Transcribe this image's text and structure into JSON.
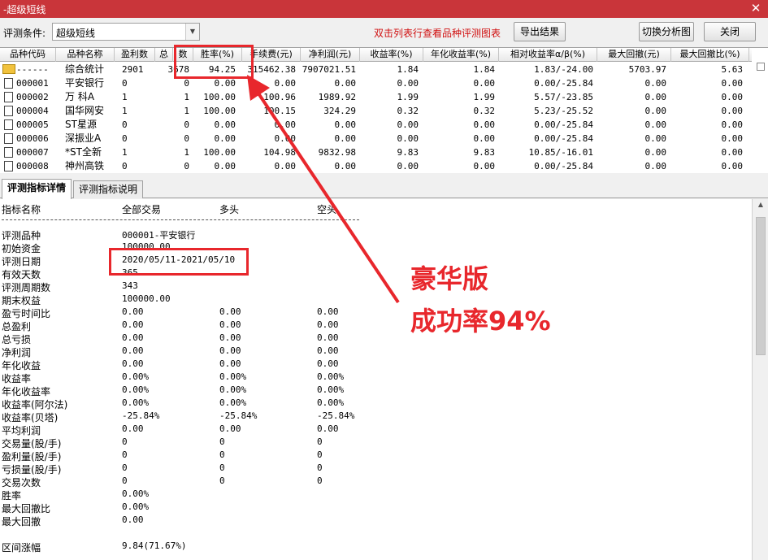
{
  "window": {
    "title": "-超级短线"
  },
  "toolbar": {
    "condition_label": "评测条件:",
    "condition_value": "超级短线",
    "hint": "双击列表行查看品种评测图表",
    "export_label": "导出结果",
    "switch_label": "切换分析图",
    "close_label": "关闭"
  },
  "grid": {
    "columns": [
      "品种代码",
      "品种名称",
      "盈利数",
      "总",
      "数",
      "胜率(%)",
      "手续费(元)",
      "净利润(元)",
      "收益率(%)",
      "年化收益率(%)",
      "相对收益率α/β(%)",
      "最大回撤(元)",
      "最大回撤比(%)"
    ],
    "rows": [
      {
        "code": "------",
        "name": "综合统计",
        "profit": "2901",
        "total": "3678",
        "win": "94.25",
        "fee": "315462.38",
        "net": "7907021.51",
        "ret": "1.84",
        "ann": "1.84",
        "rel": "1.83/-24.00",
        "dd": "5703.97",
        "ddr": "5.63"
      },
      {
        "code": "000001",
        "name": "平安银行",
        "profit": "0",
        "total": "0",
        "win": "0.00",
        "fee": "0.00",
        "net": "0.00",
        "ret": "0.00",
        "ann": "0.00",
        "rel": "0.00/-25.84",
        "dd": "0.00",
        "ddr": "0.00"
      },
      {
        "code": "000002",
        "name": "万 科A",
        "profit": "1",
        "total": "1",
        "win": "100.00",
        "fee": "100.96",
        "net": "1989.92",
        "ret": "1.99",
        "ann": "1.99",
        "rel": "5.57/-23.85",
        "dd": "0.00",
        "ddr": "0.00"
      },
      {
        "code": "000004",
        "name": "国华网安",
        "profit": "1",
        "total": "1",
        "win": "100.00",
        "fee": "100.15",
        "net": "324.29",
        "ret": "0.32",
        "ann": "0.32",
        "rel": "5.23/-25.52",
        "dd": "0.00",
        "ddr": "0.00"
      },
      {
        "code": "000005",
        "name": "ST星源",
        "profit": "0",
        "total": "0",
        "win": "0.00",
        "fee": "0.00",
        "net": "0.00",
        "ret": "0.00",
        "ann": "0.00",
        "rel": "0.00/-25.84",
        "dd": "0.00",
        "ddr": "0.00"
      },
      {
        "code": "000006",
        "name": "深振业A",
        "profit": "0",
        "total": "0",
        "win": "0.00",
        "fee": "0.00",
        "net": "0.00",
        "ret": "0.00",
        "ann": "0.00",
        "rel": "0.00/-25.84",
        "dd": "0.00",
        "ddr": "0.00"
      },
      {
        "code": "000007",
        "name": "*ST全新",
        "profit": "1",
        "total": "1",
        "win": "100.00",
        "fee": "104.98",
        "net": "9832.98",
        "ret": "9.83",
        "ann": "9.83",
        "rel": "10.85/-16.01",
        "dd": "0.00",
        "ddr": "0.00"
      },
      {
        "code": "000008",
        "name": "神州高铁",
        "profit": "0",
        "total": "0",
        "win": "0.00",
        "fee": "0.00",
        "net": "0.00",
        "ret": "0.00",
        "ann": "0.00",
        "rel": "0.00/-25.84",
        "dd": "0.00",
        "ddr": "0.00"
      }
    ]
  },
  "tabs": [
    "评测指标详情",
    "评测指标说明"
  ],
  "detail": {
    "headers": [
      "指标名称",
      "全部交易",
      "多头",
      "空头"
    ],
    "rows": [
      {
        "label": "评测品种",
        "all": "000001-平安银行",
        "long": "",
        "short": ""
      },
      {
        "label": "初始资金",
        "all": "100000.00",
        "long": "",
        "short": ""
      },
      {
        "label": "评测日期",
        "all": "2020/05/11-2021/05/10",
        "long": "",
        "short": ""
      },
      {
        "label": "有效天数",
        "all": "365",
        "long": "",
        "short": ""
      },
      {
        "label": "评测周期数",
        "all": "343",
        "long": "",
        "short": ""
      },
      {
        "label": "期末权益",
        "all": "100000.00",
        "long": "",
        "short": ""
      },
      {
        "label": "盈亏时间比",
        "all": "0.00",
        "long": "0.00",
        "short": "0.00"
      },
      {
        "label": "总盈利",
        "all": "0.00",
        "long": "0.00",
        "short": "0.00"
      },
      {
        "label": "总亏损",
        "all": "0.00",
        "long": "0.00",
        "short": "0.00"
      },
      {
        "label": "净利润",
        "all": "0.00",
        "long": "0.00",
        "short": "0.00"
      },
      {
        "label": "年化收益",
        "all": "0.00",
        "long": "0.00",
        "short": "0.00"
      },
      {
        "label": "收益率",
        "all": "0.00%",
        "long": "0.00%",
        "short": "0.00%"
      },
      {
        "label": "年化收益率",
        "all": "0.00%",
        "long": "0.00%",
        "short": "0.00%"
      },
      {
        "label": "收益率(阿尔法)",
        "all": "0.00%",
        "long": "0.00%",
        "short": "0.00%"
      },
      {
        "label": "收益率(贝塔)",
        "all": "-25.84%",
        "long": "-25.84%",
        "short": "-25.84%"
      },
      {
        "label": "平均利润",
        "all": "0.00",
        "long": "0.00",
        "short": "0.00"
      },
      {
        "label": "交易量(股/手)",
        "all": "0",
        "long": "0",
        "short": "0"
      },
      {
        "label": "盈利量(股/手)",
        "all": "0",
        "long": "0",
        "short": "0"
      },
      {
        "label": "亏损量(股/手)",
        "all": "0",
        "long": "0",
        "short": "0"
      },
      {
        "label": "交易次数",
        "all": "0",
        "long": "0",
        "short": "0"
      },
      {
        "label": "胜率",
        "all": "0.00%",
        "long": "",
        "short": ""
      },
      {
        "label": "最大回撤比",
        "all": "0.00%",
        "long": "",
        "short": ""
      },
      {
        "label": "最大回撤",
        "all": "0.00",
        "long": "",
        "short": ""
      },
      {
        "label": "",
        "all": "",
        "long": "",
        "short": ""
      },
      {
        "label": "区间涨幅",
        "all": "9.84(71.67%)",
        "long": "",
        "short": ""
      }
    ]
  },
  "promo": {
    "line1": "豪华版",
    "line2": "成功率94%"
  },
  "colors": {
    "titlebar": "#c9353a",
    "annotation_red": "#e8272c",
    "hint_red": "#d01010"
  }
}
